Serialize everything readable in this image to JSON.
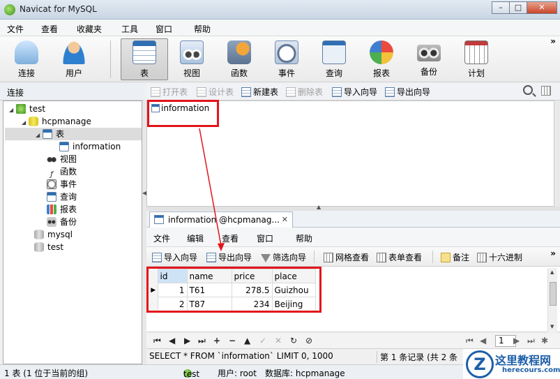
{
  "window": {
    "title": "Navicat for MySQL",
    "controls": {
      "minimize": "–",
      "maximize": "□",
      "close": "✕"
    }
  },
  "menu": [
    "文件",
    "查看",
    "收藏夹",
    "工具",
    "窗口",
    "帮助"
  ],
  "toolbar": {
    "items": [
      {
        "label": "连接",
        "icon": "plug-icon"
      },
      {
        "label": "用户",
        "icon": "user-icon"
      },
      {
        "label": "表",
        "icon": "table-icon",
        "active": true
      },
      {
        "label": "视图",
        "icon": "view-icon"
      },
      {
        "label": "函数",
        "icon": "function-icon"
      },
      {
        "label": "事件",
        "icon": "event-clock-icon"
      },
      {
        "label": "查询",
        "icon": "query-icon"
      },
      {
        "label": "报表",
        "icon": "report-icon"
      },
      {
        "label": "备份",
        "icon": "backup-icon"
      },
      {
        "label": "计划",
        "icon": "schedule-icon"
      }
    ],
    "more": "»"
  },
  "left_panel": {
    "header": "连接",
    "tree": [
      {
        "label": "test",
        "icon": "connection-icon"
      },
      {
        "label": "hcpmanage",
        "icon": "database-icon"
      },
      {
        "label": "表",
        "icon": "tables-folder-icon"
      },
      {
        "label": "information",
        "icon": "table-icon"
      },
      {
        "label": "视图",
        "icon": "view-icon"
      },
      {
        "label": "函数",
        "icon": "function-icon"
      },
      {
        "label": "事件",
        "icon": "event-icon"
      },
      {
        "label": "查询",
        "icon": "query-icon"
      },
      {
        "label": "报表",
        "icon": "report-icon"
      },
      {
        "label": "备份",
        "icon": "backup-icon"
      },
      {
        "label": "mysql",
        "icon": "database-grey-icon"
      },
      {
        "label": "test",
        "icon": "database-grey-icon"
      }
    ]
  },
  "object_toolbar": {
    "items": [
      {
        "label": "打开表",
        "disabled": true
      },
      {
        "label": "设计表",
        "disabled": true
      },
      {
        "label": "新建表",
        "disabled": false
      },
      {
        "label": "删除表",
        "disabled": true
      },
      {
        "label": "导入向导",
        "disabled": false
      },
      {
        "label": "导出向导",
        "disabled": false
      }
    ]
  },
  "objects": [
    {
      "label": "information"
    }
  ],
  "data_window": {
    "tab_label": "information @hcpmanag...",
    "menu": [
      "文件",
      "编辑",
      "查看",
      "窗口",
      "帮助"
    ],
    "toolbar": [
      "导入向导",
      "导出向导",
      "筛选向导",
      "网格查看",
      "表单查看",
      "备注",
      "十六进制"
    ],
    "grid": {
      "columns": [
        "id",
        "name",
        "price",
        "place"
      ],
      "rows": [
        [
          "1",
          "T61",
          "278.5",
          "Guizhou"
        ],
        [
          "2",
          "T87",
          "234",
          "Beijing"
        ]
      ]
    },
    "nav": {
      "page": "1"
    },
    "sql": "SELECT * FROM `information` LIMIT 0, 1000",
    "records": "第 1 条记录 (共 2 条"
  },
  "status_bar": {
    "selection": "1 表 (1 位于当前的组)",
    "connection": "test",
    "user": "用户: root",
    "database": "数据库: hcpmanage"
  },
  "watermark": {
    "title": "这里教程网",
    "url": "herecours.com"
  },
  "colors": {
    "annotation_red": "#e3141b",
    "accent_blue": "#2f6fb4"
  }
}
